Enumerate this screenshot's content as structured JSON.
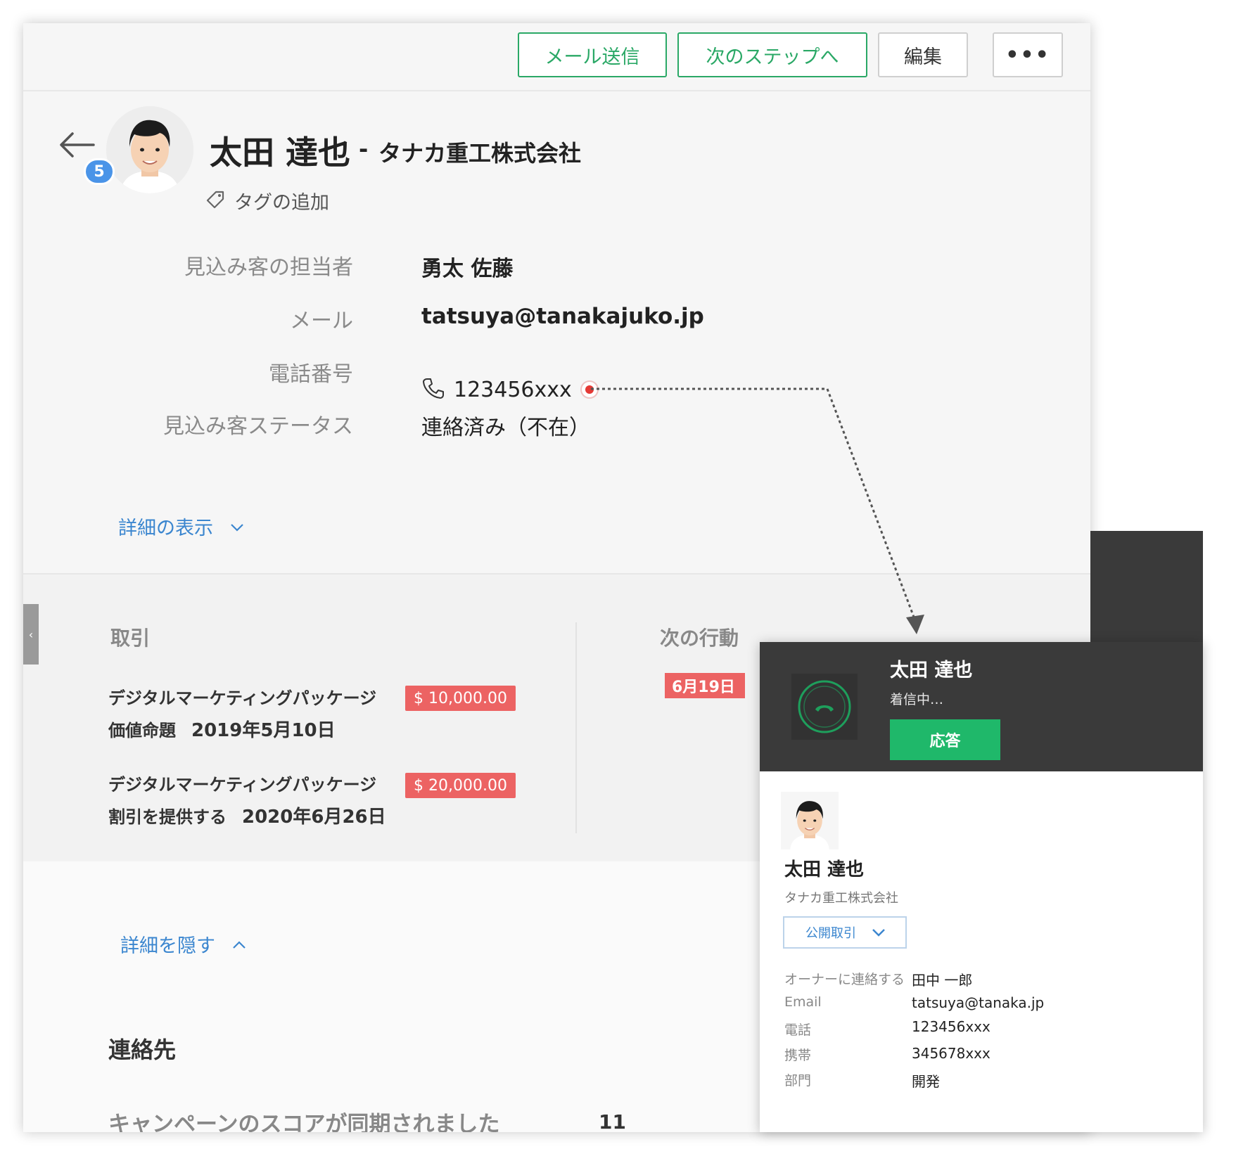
{
  "toolbar": {
    "send_mail": "メール送信",
    "next_step": "次のステップへ",
    "edit": "編集",
    "more": "•••"
  },
  "header": {
    "name": "太田 達也",
    "separator": "-",
    "company": "タナカ重工株式会社",
    "badge_count": "5",
    "add_tag": "タグの追加"
  },
  "fields": {
    "owner_label": "見込み客の担当者",
    "owner_value": "勇太 佐藤",
    "email_label": "メール",
    "email_value": "tatsuya@tanakajuko.jp",
    "phone_label": "電話番号",
    "phone_value": "123456xxx",
    "status_label": "見込み客ステータス",
    "status_value": "連絡済み（不在）"
  },
  "show_details": "詳細の表示",
  "deals": {
    "title": "取引",
    "items": [
      {
        "name": "デジタルマーケティングパッケージ",
        "amount": "$ 10,000.00",
        "stage": "価値命題",
        "date": "2019年5月10日"
      },
      {
        "name": "デジタルマーケティングパッケージ",
        "amount": "$ 20,000.00",
        "stage": "割引を提供する",
        "date": "2020年6月26日"
      }
    ]
  },
  "next_action": {
    "title": "次の行動",
    "date": "6月19日"
  },
  "hide_details": "詳細を隠す",
  "contacts_title": "連絡先",
  "campaign": {
    "text": "キャンペーンのスコアが同期されました",
    "count": "11"
  },
  "call_popup": {
    "caller_name": "太田 達也",
    "status": "着信中…",
    "answer": "応答",
    "contact_name": "太田 達也",
    "company": "タナカ重工株式会社",
    "deal_select": "公開取引",
    "rows": [
      {
        "label": "オーナーに連絡する",
        "value": "田中 一郎"
      },
      {
        "label": "Email",
        "value": "tatsuya@tanaka.jp"
      },
      {
        "label": "電話",
        "value": "123456xxx"
      },
      {
        "label": "携帯",
        "value": "345678xxx"
      },
      {
        "label": "部門",
        "value": "開発"
      }
    ]
  },
  "colors": {
    "accent_green": "#2aa866",
    "link_blue": "#3b86cf",
    "amount_red": "#ec6363",
    "popup_dark": "#3a3a3a",
    "answer_green": "#1fb86a"
  },
  "icons": [
    "back-arrow-icon",
    "tag-icon",
    "phone-icon",
    "recording-dot-icon",
    "chevron-down-icon",
    "chevron-up-icon",
    "incoming-call-icon"
  ]
}
